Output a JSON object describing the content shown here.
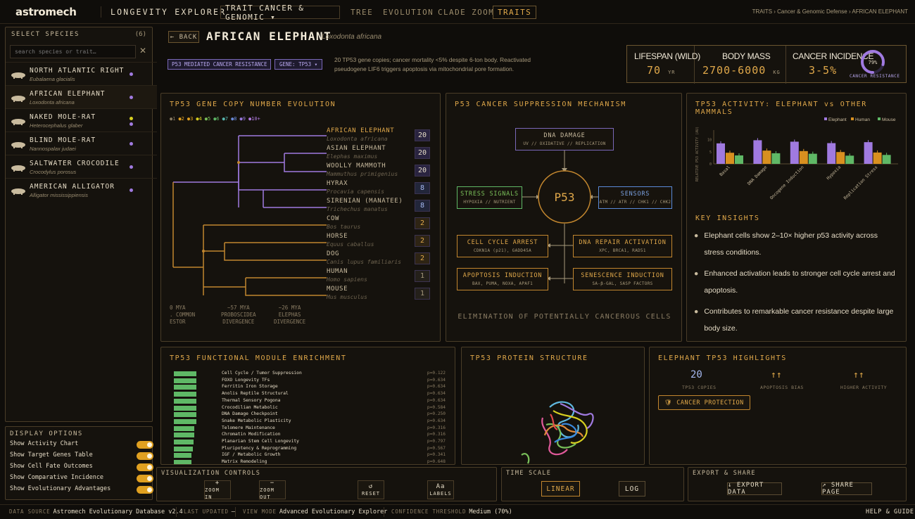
{
  "header": {
    "logo": "astromech",
    "app_title": "LONGEVITY EXPLORER",
    "trait_dropdown": "TRAIT CANCER & GENOMIC ▾",
    "nav": [
      "TREE",
      "EVOLUTION",
      "CLADE ZOOM",
      "TRAITS"
    ],
    "active_nav": "TRAITS",
    "breadcrumb": [
      "TRAITS",
      "Cancer & Genomic Defense",
      "AFRICAN ELEPHANT"
    ]
  },
  "sidebar": {
    "title": "SELECT SPECIES",
    "count": "(6)",
    "search_placeholder": "search species or trait…",
    "species": [
      {
        "name": "NORTH ATLANTIC RIGHT WHALE",
        "latin": "Eubalaena glacialis",
        "icon": "whale-icon"
      },
      {
        "name": "AFRICAN ELEPHANT",
        "latin": "Loxodonta africana",
        "icon": "elephant-icon"
      },
      {
        "name": "NAKED MOLE-RAT",
        "latin": "Heterocephalus glaber",
        "icon": "mole-rat-icon"
      },
      {
        "name": "BLIND MOLE-RAT",
        "latin": "Nannospalax judaei",
        "icon": "blind-mole-rat-icon"
      },
      {
        "name": "SALTWATER CROCODILE",
        "latin": "Crocodylus porosus",
        "icon": "crocodile-icon"
      },
      {
        "name": "AMERICAN ALLIGATOR",
        "latin": "Alligator mississippiensis",
        "icon": "alligator-icon"
      }
    ],
    "options_title": "DISPLAY OPTIONS",
    "options": [
      "Show Activity Chart",
      "Show Target Genes Table",
      "Show Cell Fate Outcomes",
      "Show Comparative Incidence",
      "Show Evolutionary Advantages"
    ]
  },
  "species_header": {
    "back": "← BACK",
    "name": "AFRICAN ELEPHANT",
    "latin": "Loxodonta africana",
    "tag1": "P53 MEDIATED CANCER RESISTANCE",
    "tag2": "GENE: TP53 ▾",
    "description": "20 TP53 gene copies; cancer mortality <5% despite 6-ton body. Reactivated pseudogene LIF6 triggers apoptosis via mitochondrial pore formation."
  },
  "stats": {
    "lifespan_label": "LIFESPAN (WILD)",
    "lifespan_value": "70",
    "lifespan_unit": "YR",
    "mass_label": "BODY MASS",
    "mass_value": "2700-6000",
    "mass_unit": "KG",
    "incidence_label": "CANCER INCIDENCE",
    "incidence_value": "3-5%",
    "resistance_pct": "79%",
    "resistance_fraction": 0.79,
    "resistance_label": "CANCER RESISTANCE"
  },
  "tree_panel": {
    "title": "TP53 GENE COPY NUMBER EVOLUTION",
    "legend": [
      "1",
      "2",
      "3",
      "4",
      "5",
      "6",
      "7",
      "8",
      "9",
      "10+"
    ],
    "legend_colors": [
      "#8a7c63",
      "#e0a020",
      "#e0a020",
      "#d8d020",
      "#7ac05a",
      "#5fb866",
      "#58b8b0",
      "#6a8ad8",
      "#9a7ae0",
      "#b07ae0"
    ],
    "taxa": [
      {
        "name": "AFRICAN ELEPHANT",
        "latin": "Loxodonta africana",
        "copies": "20",
        "highlight": true
      },
      {
        "name": "ASIAN ELEPHANT",
        "latin": "Elephas maximus",
        "copies": "20"
      },
      {
        "name": "WOOLLY MAMMOTH",
        "latin": "Mammuthus primigenius",
        "copies": "20"
      },
      {
        "name": "HYRAX",
        "latin": "Procavia capensis",
        "copies": "8"
      },
      {
        "name": "SIRENIAN (MANATEE)",
        "latin": "Trichechus manatus",
        "copies": "8"
      },
      {
        "name": "COW",
        "latin": "Bos taurus",
        "copies": "2"
      },
      {
        "name": "HORSE",
        "latin": "Equus caballus",
        "copies": "2"
      },
      {
        "name": "DOG",
        "latin": "Canis lupus familiaris",
        "copies": "2"
      },
      {
        "name": "HUMAN",
        "latin": "Homo sapiens",
        "copies": "1"
      },
      {
        "name": "MOUSE",
        "latin": "Mus musculus",
        "copies": "1"
      }
    ],
    "axis": [
      {
        "t1": "0 MYA",
        "t2": ". COMMON",
        "t3": "ESTOR"
      },
      {
        "t1": "~57 MYA",
        "t2": "PROBOSCIDEA",
        "t3": "DIVERGENCE"
      },
      {
        "t1": "~26 MYA",
        "t2": "ELEPHAS",
        "t3": "DIVERGENCE"
      }
    ]
  },
  "mechanism": {
    "title": "P53 CANCER SUPPRESSION MECHANISM",
    "center": "P53",
    "dna_damage": {
      "title": "DNA DAMAGE",
      "sub": "UV // OXIDATIVE // REPLICATION"
    },
    "stress": {
      "title": "STRESS SIGNALS",
      "sub": "HYPOXIA // NUTRIENT"
    },
    "sensors": {
      "title": "SENSORS",
      "sub": "ATM // ATR // CHK1 // CHK2"
    },
    "cell_cycle": {
      "title": "CELL CYCLE ARREST",
      "sub": "CDKN1A (p21), GADD45A"
    },
    "dna_repair": {
      "title": "DNA REPAIR ACTIVATION",
      "sub": "XPC, BRCA1, RAD51"
    },
    "apoptosis": {
      "title": "APOPTOSIS INDUCTION",
      "sub": "BAX, PUMA, NOXA, APAF1"
    },
    "senescence": {
      "title": "SENESCENCE INDUCTION",
      "sub": "SA-β-GAL, SASP FACTORS"
    },
    "footer": "ELIMINATION OF POTENTIALLY CANCEROUS CELLS"
  },
  "chart_data": {
    "type": "bar",
    "title": "TP53 ACTIVITY: ELEPHANT vs OTHER MAMMALS",
    "ylabel": "RELATIVE P53 ACTIVITY (AU)",
    "ylim": [
      0,
      14
    ],
    "yticks": [
      0,
      5,
      10
    ],
    "categories": [
      "Basal",
      "DNA Damage",
      "Oncogene Induction",
      "Hypoxia",
      "Replication Stress"
    ],
    "series": [
      {
        "name": "Elephant",
        "color": "#a07ae0",
        "values": [
          8.5,
          9.8,
          9.2,
          8.6,
          9.0
        ]
      },
      {
        "name": "Human",
        "color": "#d89020",
        "values": [
          4.6,
          5.5,
          5.3,
          4.9,
          4.7
        ]
      },
      {
        "name": "Mouse",
        "color": "#5fb866",
        "values": [
          3.5,
          4.4,
          4.2,
          3.4,
          3.7
        ]
      }
    ]
  },
  "insights": {
    "title": "KEY INSIGHTS",
    "items": [
      "Elephant cells show 2–10× higher p53 activity across stress conditions.",
      "Enhanced activation leads to stronger cell cycle arrest and apoptosis.",
      "Contributes to remarkable cancer resistance despite large body size."
    ]
  },
  "enrichment": {
    "title": "TP53 FUNCTIONAL MODULE ENRICHMENT",
    "modules": [
      {
        "label": "Cell Cycle / Tumor Suppression",
        "p": "p=0.122",
        "w": 0.45
      },
      {
        "label": "FOXO Longevity TFs",
        "p": "p=0.634",
        "w": 0.45
      },
      {
        "label": "Ferritin Iron Storage",
        "p": "p=0.634",
        "w": 0.45
      },
      {
        "label": "Anolis Reptile Structural",
        "p": "p=0.634",
        "w": 0.45
      },
      {
        "label": "Thermal Sensory Pogona",
        "p": "p=0.634",
        "w": 0.45
      },
      {
        "label": "Crocodilian Metabolic",
        "p": "p=0.584",
        "w": 0.45
      },
      {
        "label": "DNA Damage Checkpoint",
        "p": "p=0.250",
        "w": 0.45
      },
      {
        "label": "Snake Metabolic Plasticity",
        "p": "p=0.634",
        "w": 0.45
      },
      {
        "label": "Telomere Maintenance",
        "p": "p=0.316",
        "w": 0.42
      },
      {
        "label": "Chromatin Modification",
        "p": "p=0.316",
        "w": 0.42
      },
      {
        "label": "Planarian Stem Cell Longevity",
        "p": "p=0.797",
        "w": 0.4
      },
      {
        "label": "Pluripotency & Reprogramming",
        "p": "p=0.567",
        "w": 0.38
      },
      {
        "label": "IGF / Metabolic Growth",
        "p": "p=0.341",
        "w": 0.36
      },
      {
        "label": "Matrix Remodeling",
        "p": "p=0.648",
        "w": 0.35
      }
    ]
  },
  "protein": {
    "title": "TP53 PROTEIN STRUCTURE"
  },
  "highlights": {
    "title": "ELEPHANT TP53 HIGHLIGHTS",
    "copies": "20",
    "copies_label": "TP53 COPIES",
    "apoptosis_val": "↑↑",
    "apoptosis_label": "APOPTOSIS BIAS",
    "activity_val": "↑↑",
    "activity_label": "HIGHER ACTIVITY",
    "badge": "CANCER PROTECTION"
  },
  "viz_controls": {
    "title": "VISUALIZATION CONTROLS",
    "buttons": [
      {
        "sym": "+",
        "label": "ZOOM IN"
      },
      {
        "sym": "−",
        "label": "ZOOM OUT"
      },
      {
        "sym": "↺",
        "label": "RESET"
      },
      {
        "sym": "Aa",
        "label": "LABELS"
      }
    ]
  },
  "time_scale": {
    "title": "TIME SCALE",
    "linear": "LINEAR",
    "log": "LOG"
  },
  "export": {
    "title": "EXPORT & SHARE",
    "export_btn": "↓ EXPORT DATA",
    "share_btn": "↗ SHARE PAGE"
  },
  "footer": {
    "source_k": "DATA SOURCE",
    "source_v": "Astromech Evolutionary Database v2.4",
    "updated_k": "LAST UPDATED",
    "updated_v": "—",
    "mode_k": "VIEW MODE",
    "mode_v": "Advanced Evolutionary Explorer",
    "conf_k": "CONFIDENCE THRESHOLD",
    "conf_v": "Medium (70%)",
    "help": "HELP & GUIDE"
  }
}
